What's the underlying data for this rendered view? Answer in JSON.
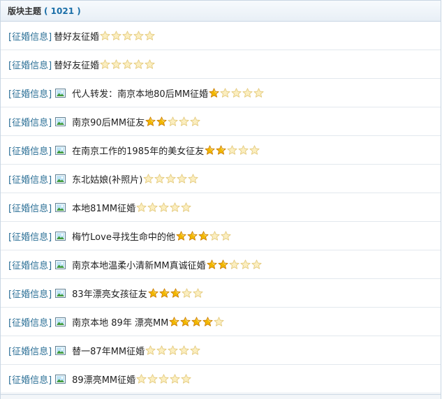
{
  "header": {
    "title": "版块主题",
    "count": "( 1021 )"
  },
  "rows": [
    {
      "tag": "[征婚信息]",
      "title": "替好友征婚",
      "has_image": false,
      "rating": 0
    },
    {
      "tag": "[征婚信息]",
      "title": "替好友征婚",
      "has_image": false,
      "rating": 0
    },
    {
      "tag": "[征婚信息]",
      "title": "代人转发：南京本地80后MM征婚",
      "has_image": true,
      "rating": 1
    },
    {
      "tag": "[征婚信息]",
      "title": "南京90后MM征友",
      "has_image": true,
      "rating": 2
    },
    {
      "tag": "[征婚信息]",
      "title": "在南京工作的1985年的美女征友",
      "has_image": true,
      "rating": 2
    },
    {
      "tag": "[征婚信息]",
      "title": "东北姑娘(补照片)",
      "has_image": true,
      "rating": 0
    },
    {
      "tag": "[征婚信息]",
      "title": "本地81MM征婚",
      "has_image": true,
      "rating": 0
    },
    {
      "tag": "[征婚信息]",
      "title": "梅竹Love寻找生命中的他",
      "has_image": true,
      "rating": 3
    },
    {
      "tag": "[征婚信息]",
      "title": "南京本地温柔小清新MM真诚征婚",
      "has_image": true,
      "rating": 2
    },
    {
      "tag": "[征婚信息]",
      "title": "83年漂亮女孩征友",
      "has_image": true,
      "rating": 3
    },
    {
      "tag": "[征婚信息]",
      "title": "南京本地 89年 漂亮MM",
      "has_image": true,
      "rating": 4
    },
    {
      "tag": "[征婚信息]",
      "title": "替一87年MM征婚",
      "has_image": true,
      "rating": 0
    },
    {
      "tag": "[征婚信息]",
      "title": "89漂亮MM征婚",
      "has_image": true,
      "rating": 0
    }
  ],
  "rating_max": 5,
  "colors": {
    "tag": "#2b6f96",
    "count": "#1b6fa8",
    "star_filled": "#f2b800",
    "star_empty": "#fbeec0"
  },
  "icons": {
    "image": "image-icon",
    "star_filled": "star-filled-icon",
    "star_empty": "star-empty-icon"
  }
}
